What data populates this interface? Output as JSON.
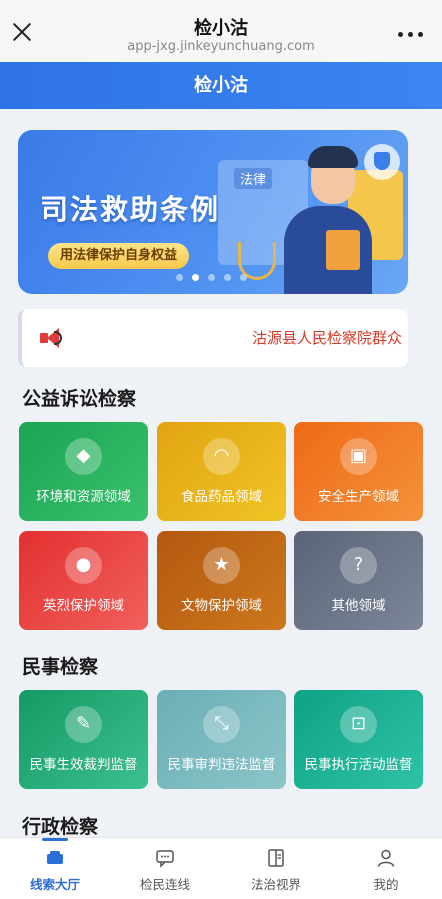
{
  "browser": {
    "title": "检小沽",
    "url": "app-jxg.jinkeyunchuang.com"
  },
  "header": {
    "title": "检小沽"
  },
  "banner": {
    "title": "司法救助条例",
    "pill": "用法律保护自身权益",
    "doc_label": "法律",
    "slides": 5,
    "active_slide": 2
  },
  "notice": {
    "text": "沽源县人民检察院群众"
  },
  "sections": {
    "public": {
      "title": "公益诉讼检察",
      "items": [
        {
          "label": "环境和资源领域",
          "icon": "paint-bucket-icon",
          "glyph": "◆"
        },
        {
          "label": "食品药品领域",
          "icon": "food-tray-icon",
          "glyph": "◠"
        },
        {
          "label": "安全生产领域",
          "icon": "safety-box-icon",
          "glyph": "▣"
        },
        {
          "label": "英烈保护领域",
          "icon": "person-icon",
          "glyph": "●"
        },
        {
          "label": "文物保护领域",
          "icon": "star-icon",
          "glyph": "★"
        },
        {
          "label": "其他领域",
          "icon": "question-icon",
          "glyph": "?"
        }
      ]
    },
    "civil": {
      "title": "民事检察",
      "items": [
        {
          "label": "民事生效裁判监督",
          "icon": "pencil-icon",
          "glyph": "✎"
        },
        {
          "label": "民事审判违法监督",
          "icon": "shrink-arrows-icon",
          "glyph": "⤡"
        },
        {
          "label": "民事执行活动监督",
          "icon": "robot-icon",
          "glyph": "⊡"
        }
      ]
    },
    "admin": {
      "title": "行政检察"
    }
  },
  "tabs": [
    {
      "label": "线索大厅",
      "icon": "sofa-icon",
      "active": true
    },
    {
      "label": "检民连线",
      "icon": "chat-bubble-icon",
      "active": false
    },
    {
      "label": "法治视界",
      "icon": "book-icon",
      "active": false
    },
    {
      "label": "我的",
      "icon": "user-icon",
      "active": false
    }
  ],
  "colors": {
    "brand": "#2f72e6",
    "notice": "#d63a2a",
    "tab_active": "#2d6fd9"
  }
}
